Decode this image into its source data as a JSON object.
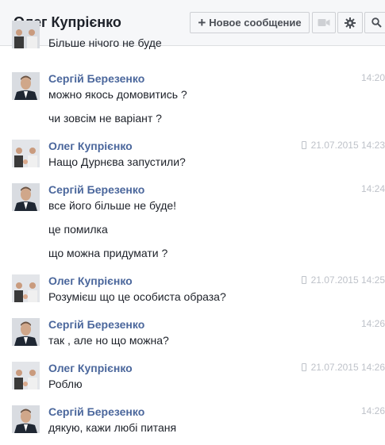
{
  "header": {
    "title": "Олег Купрієнко",
    "new_message_label": "Новое сообщение",
    "icons": [
      "plus-icon",
      "video-camera-icon",
      "gear-icon",
      "search-icon"
    ]
  },
  "messages": [
    {
      "text": "Більше нічого не буде"
    },
    {
      "sender": "Сергій Березенко",
      "time": "14:20",
      "mobile": false,
      "lines": [
        "можно якось домовитись ?",
        "чи зовсім не варіант ?"
      ]
    },
    {
      "sender": "Олег Купрієнко",
      "time": "21.07.2015 14:23",
      "mobile": true,
      "lines": [
        "Нащо Дурнєва запустили?"
      ]
    },
    {
      "sender": "Сергій Березенко",
      "time": "14:24",
      "mobile": false,
      "lines": [
        "все його більше не буде!",
        "це помилка",
        "що можна придумати ?"
      ]
    },
    {
      "sender": "Олег Купрієнко",
      "time": "21.07.2015 14:25",
      "mobile": true,
      "lines": [
        "Розумієш що це особиста образа?"
      ]
    },
    {
      "sender": "Сергій Березенко",
      "time": "14:26",
      "mobile": false,
      "lines": [
        "так , але но що можна?"
      ]
    },
    {
      "sender": "Олег Купрієнко",
      "time": "21.07.2015 14:26",
      "mobile": true,
      "lines": [
        "Роблю"
      ]
    },
    {
      "sender": "Сергій Березенко",
      "time": "14:26",
      "mobile": false,
      "lines": [
        "дякую, кажи любі питаня"
      ]
    }
  ]
}
